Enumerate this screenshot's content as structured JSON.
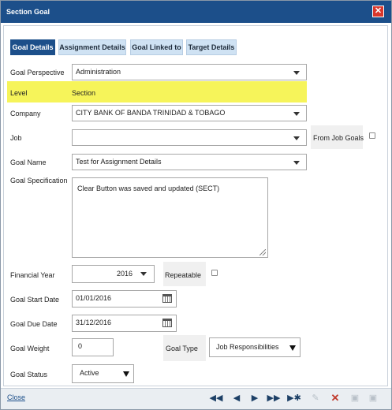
{
  "window": {
    "title": "Section Goal"
  },
  "tabs": [
    {
      "label": "Goal Details"
    },
    {
      "label": "Assignment Details"
    },
    {
      "label": "Goal Linked to"
    },
    {
      "label": "Target Details"
    }
  ],
  "form": {
    "goal_perspective": {
      "label": "Goal Perspective",
      "value": "Administration"
    },
    "level": {
      "label": "Level",
      "value": "Section"
    },
    "company": {
      "label": "Company",
      "value": "CITY BANK OF BANDA TRINIDAD & TOBAGO"
    },
    "job": {
      "label": "Job",
      "value": "",
      "from_job_goals_label": "From Job Goals"
    },
    "goal_name": {
      "label": "Goal Name",
      "value": "Test for Assignment Details"
    },
    "goal_specification": {
      "label": "Goal Specification",
      "value": "Clear Button was saved and updated (SECT)"
    },
    "financial_year": {
      "label": "Financial Year",
      "value": "2016",
      "repeatable_label": "Repeatable"
    },
    "goal_start_date": {
      "label": "Goal Start Date",
      "value": "01/01/2016"
    },
    "goal_due_date": {
      "label": "Goal Due Date",
      "value": "31/12/2016"
    },
    "goal_weight": {
      "label": "Goal Weight",
      "value": "0"
    },
    "goal_type": {
      "label": "Goal Type",
      "value": "Job Responsibilities"
    },
    "goal_status": {
      "label": "Goal Status",
      "value": "Active"
    }
  },
  "footer": {
    "close_label": "Close",
    "icons": [
      "first-icon",
      "previous-icon",
      "next-icon",
      "last-icon",
      "new-record-icon",
      "edit-icon",
      "delete-icon",
      "save-icon",
      "save-as-icon"
    ]
  },
  "colors": {
    "titlebar": "#1c4f8a",
    "highlight": "#f6f45a",
    "delete": "#c0392b"
  }
}
